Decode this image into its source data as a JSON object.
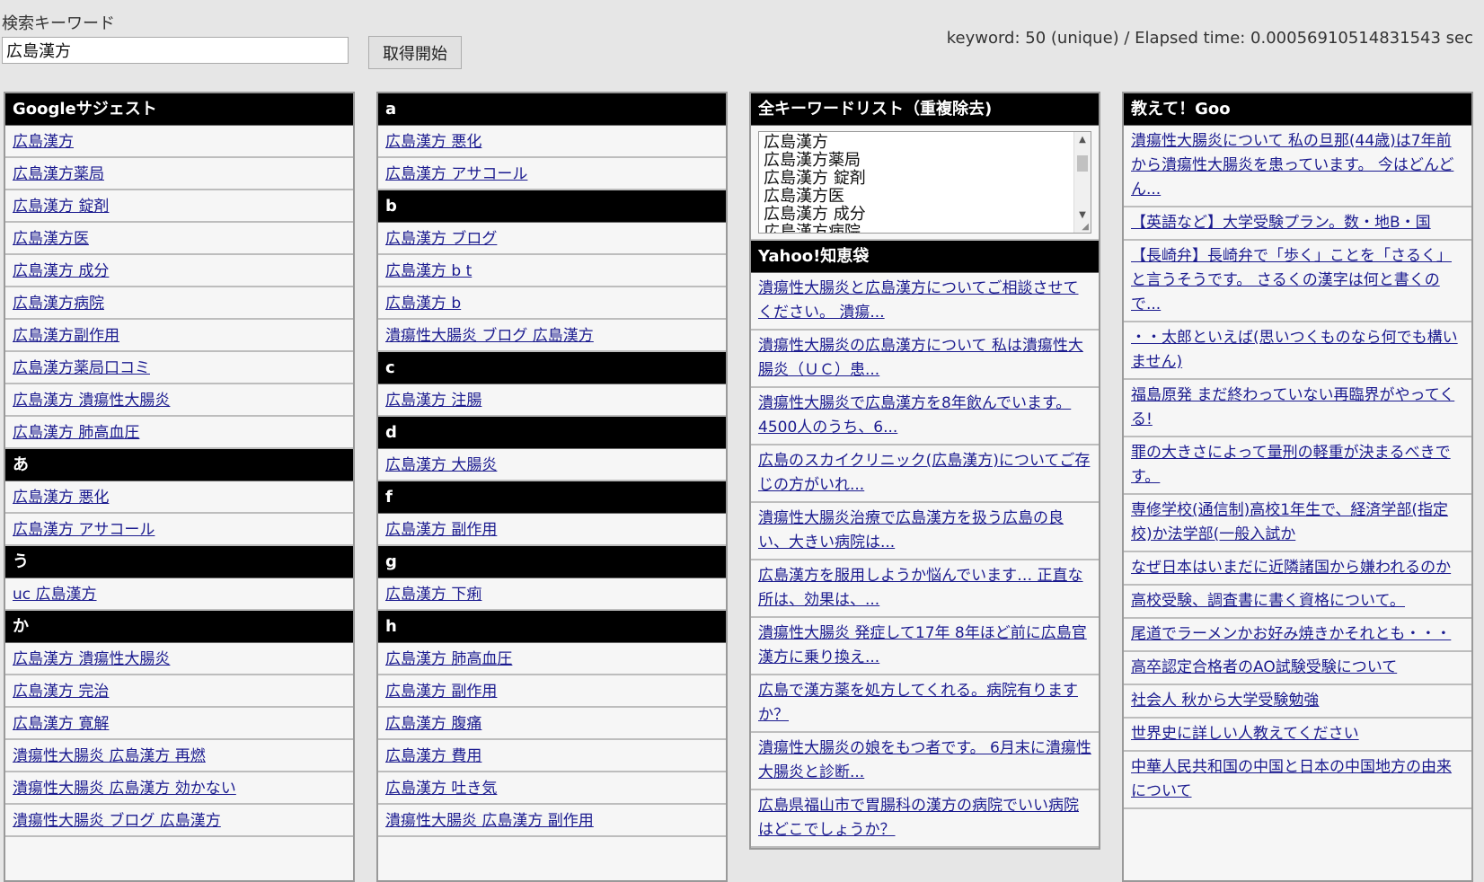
{
  "search": {
    "label": "検索キーワード",
    "value": "広島漢方",
    "button": "取得開始"
  },
  "stats": "keyword: 50 (unique) / Elapsed time: 0.00056910514831543 sec",
  "google": {
    "title": "Googleサジェスト",
    "rows": [
      {
        "type": "item",
        "text": "広島漢方"
      },
      {
        "type": "item",
        "text": "広島漢方薬局"
      },
      {
        "type": "item",
        "text": "広島漢方 錠剤"
      },
      {
        "type": "item",
        "text": "広島漢方医"
      },
      {
        "type": "item",
        "text": "広島漢方 成分"
      },
      {
        "type": "item",
        "text": "広島漢方病院"
      },
      {
        "type": "item",
        "text": "広島漢方副作用"
      },
      {
        "type": "item",
        "text": "広島漢方薬局口コミ"
      },
      {
        "type": "item",
        "text": "広島漢方 潰瘍性大腸炎"
      },
      {
        "type": "item",
        "text": "広島漢方 肺高血圧"
      },
      {
        "type": "header",
        "text": "あ"
      },
      {
        "type": "item",
        "text": "広島漢方 悪化"
      },
      {
        "type": "item",
        "text": "広島漢方 アサコール"
      },
      {
        "type": "header",
        "text": "う"
      },
      {
        "type": "item",
        "text": "uc 広島漢方"
      },
      {
        "type": "header",
        "text": "か"
      },
      {
        "type": "item",
        "text": "広島漢方 潰瘍性大腸炎"
      },
      {
        "type": "item",
        "text": "広島漢方 完治"
      },
      {
        "type": "item",
        "text": "広島漢方 寛解"
      },
      {
        "type": "item",
        "text": "潰瘍性大腸炎 広島漢方 再燃"
      },
      {
        "type": "item",
        "text": "潰瘍性大腸炎 広島漢方 効かない"
      },
      {
        "type": "item",
        "text": "潰瘍性大腸炎 ブログ 広島漢方"
      }
    ]
  },
  "alpha": {
    "rows": [
      {
        "type": "header",
        "text": "a"
      },
      {
        "type": "item",
        "text": "広島漢方 悪化"
      },
      {
        "type": "item",
        "text": "広島漢方 アサコール"
      },
      {
        "type": "header",
        "text": "b"
      },
      {
        "type": "item",
        "text": "広島漢方 ブログ"
      },
      {
        "type": "item",
        "text": "広島漢方 b t"
      },
      {
        "type": "item",
        "text": "広島漢方 b"
      },
      {
        "type": "item",
        "text": "潰瘍性大腸炎 ブログ 広島漢方"
      },
      {
        "type": "header",
        "text": "c"
      },
      {
        "type": "item",
        "text": "広島漢方 注腸"
      },
      {
        "type": "header",
        "text": "d"
      },
      {
        "type": "item",
        "text": "広島漢方 大腸炎"
      },
      {
        "type": "header",
        "text": "f"
      },
      {
        "type": "item",
        "text": "広島漢方 副作用"
      },
      {
        "type": "header",
        "text": "g"
      },
      {
        "type": "item",
        "text": "広島漢方 下痢"
      },
      {
        "type": "header",
        "text": "h"
      },
      {
        "type": "item",
        "text": "広島漢方 肺高血圧"
      },
      {
        "type": "item",
        "text": "広島漢方 副作用"
      },
      {
        "type": "item",
        "text": "広島漢方 腹痛"
      },
      {
        "type": "item",
        "text": "広島漢方 費用"
      },
      {
        "type": "item",
        "text": "広島漢方 吐き気"
      },
      {
        "type": "item",
        "text": "潰瘍性大腸炎 広島漢方 副作用"
      }
    ]
  },
  "all_keywords": {
    "title": "全キーワードリスト（重複除去)",
    "items": [
      "広島漢方",
      "広島漢方薬局",
      "広島漢方 錠剤",
      "広島漢方医",
      "広島漢方 成分",
      "広島漢方病院"
    ]
  },
  "yahoo": {
    "title": "Yahoo!知恵袋",
    "items": [
      "潰瘍性大腸炎と広島漢方についてご相談させてください。 潰瘍...",
      "潰瘍性大腸炎の広島漢方について 私は潰瘍性大腸炎（ＵＣ）患...",
      "潰瘍性大腸炎で広島漢方を8年飲んでいます。4500人のうち、6...",
      "広島のスカイクリニック(広島漢方)についてご存じの方がいれ...",
      "潰瘍性大腸炎治療で広島漢方を扱う広島の良い、大きい病院は...",
      "広島漢方を服用しようか悩んでいます… 正直な所は、効果は、...",
      "潰瘍性大腸炎 発症して17年 8年ほど前に広島官漢方に乗り換え...",
      "広島で漢方薬を処方してくれる。病院有りますか？",
      "潰瘍性大腸炎の娘をもつ者です。 6月末に潰瘍性大腸炎と診断...",
      "広島県福山市で胃腸科の漢方の病院でいい病院はどこでしょうか？"
    ]
  },
  "goo": {
    "title": "教えて！Goo",
    "items": [
      "潰瘍性大腸炎について 私の旦那(44歳)は7年前から潰瘍性大腸炎を患っています。 今はどんどん...",
      "【英語など】大学受験プラン。数・地B・国",
      "【長崎弁】長崎弁で「歩く」ことを「さるく」と言うそうです。 さるくの漢字は何と書くので...",
      "・・太郎といえば(思いつくものなら何でも構いません)",
      "福島原発 まだ終わっていない再臨界がやってくる!",
      "罪の大きさによって量刑の軽重が決まるべきです。",
      "専修学校(通信制)高校1年生で、経済学部(指定校)か法学部(一般入試か",
      "なぜ日本はいまだに近隣諸国から嫌われるのか",
      "高校受験、調査書に書く資格について。",
      "尾道でラーメンかお好み焼きかそれとも・・・",
      "高卒認定合格者のAO試験受験について",
      "社会人 秋から大学受験勉強",
      "世界史に詳しい人教えてください",
      "中華人民共和国の中国と日本の中国地方の由来について"
    ]
  }
}
